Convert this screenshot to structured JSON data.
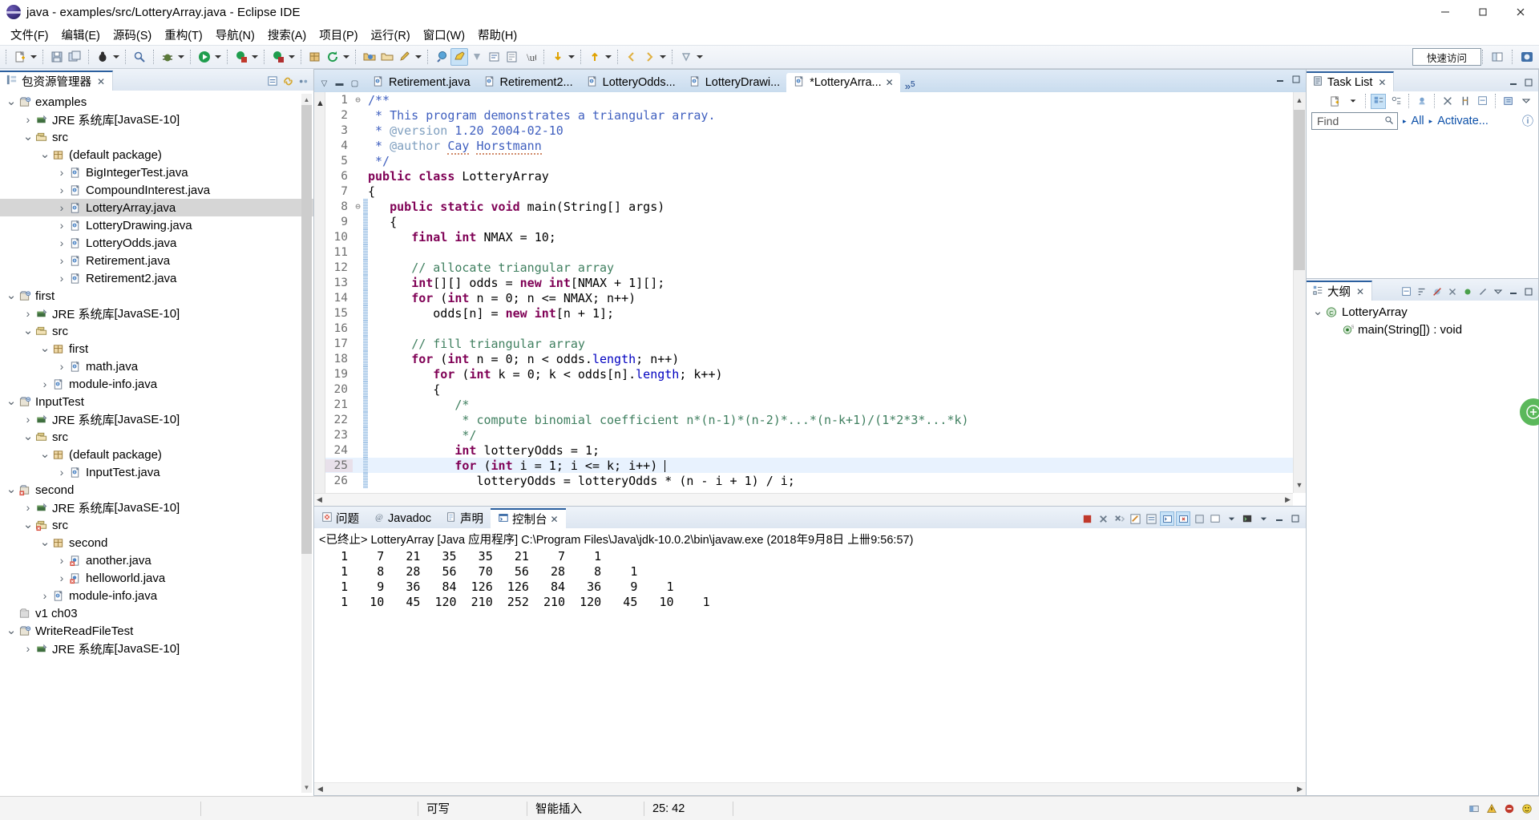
{
  "window": {
    "title": "java - examples/src/LotteryArray.java - Eclipse IDE",
    "app_icon": "eclipse-icon",
    "minimize": "—",
    "maximize": "❐",
    "close": "✕"
  },
  "menubar": {
    "items": [
      {
        "label": "文件(F)",
        "name": "menu-file"
      },
      {
        "label": "编辑(E)",
        "name": "menu-edit"
      },
      {
        "label": "源码(S)",
        "name": "menu-source"
      },
      {
        "label": "重构(T)",
        "name": "menu-refactor"
      },
      {
        "label": "导航(N)",
        "name": "menu-navigate"
      },
      {
        "label": "搜索(A)",
        "name": "menu-search"
      },
      {
        "label": "项目(P)",
        "name": "menu-project"
      },
      {
        "label": "运行(R)",
        "name": "menu-run"
      },
      {
        "label": "窗口(W)",
        "name": "menu-window"
      },
      {
        "label": "帮助(H)",
        "name": "menu-help"
      }
    ]
  },
  "toolbar": {
    "quick_access": "快速访问"
  },
  "package_explorer": {
    "tab_label": "包资源管理器",
    "tree": [
      {
        "indent": 0,
        "twist": "open",
        "icon": "java-project-icon",
        "label": "examples",
        "dim": ""
      },
      {
        "indent": 1,
        "twist": "closed",
        "icon": "jre-library-icon",
        "label": "JRE 系统库 ",
        "dim": "[JavaSE-10]"
      },
      {
        "indent": 1,
        "twist": "open",
        "icon": "source-folder-icon",
        "label": "src",
        "dim": ""
      },
      {
        "indent": 2,
        "twist": "open",
        "icon": "package-icon",
        "label": "(default package)",
        "dim": ""
      },
      {
        "indent": 3,
        "twist": "closed",
        "icon": "java-file-icon",
        "label": "BigIntegerTest.java",
        "dim": ""
      },
      {
        "indent": 3,
        "twist": "closed",
        "icon": "java-file-icon",
        "label": "CompoundInterest.java",
        "dim": ""
      },
      {
        "indent": 3,
        "twist": "closed",
        "icon": "java-file-icon",
        "label": "LotteryArray.java",
        "dim": "",
        "selected": true
      },
      {
        "indent": 3,
        "twist": "closed",
        "icon": "java-file-icon",
        "label": "LotteryDrawing.java",
        "dim": ""
      },
      {
        "indent": 3,
        "twist": "closed",
        "icon": "java-file-icon",
        "label": "LotteryOdds.java",
        "dim": ""
      },
      {
        "indent": 3,
        "twist": "closed",
        "icon": "java-file-icon",
        "label": "Retirement.java",
        "dim": ""
      },
      {
        "indent": 3,
        "twist": "closed",
        "icon": "java-file-icon",
        "label": "Retirement2.java",
        "dim": ""
      },
      {
        "indent": 0,
        "twist": "open",
        "icon": "java-project-icon",
        "label": "first",
        "dim": ""
      },
      {
        "indent": 1,
        "twist": "closed",
        "icon": "jre-library-icon",
        "label": "JRE 系统库 ",
        "dim": "[JavaSE-10]"
      },
      {
        "indent": 1,
        "twist": "open",
        "icon": "source-folder-icon",
        "label": "src",
        "dim": ""
      },
      {
        "indent": 2,
        "twist": "open",
        "icon": "package-icon",
        "label": "first",
        "dim": ""
      },
      {
        "indent": 3,
        "twist": "closed",
        "icon": "java-file-icon",
        "label": "math.java",
        "dim": ""
      },
      {
        "indent": 2,
        "twist": "closed",
        "icon": "java-file-icon",
        "label": "module-info.java",
        "dim": ""
      },
      {
        "indent": 0,
        "twist": "open",
        "icon": "java-project-icon",
        "label": "InputTest",
        "dim": ""
      },
      {
        "indent": 1,
        "twist": "closed",
        "icon": "jre-library-icon",
        "label": "JRE 系统库 ",
        "dim": "[JavaSE-10]"
      },
      {
        "indent": 1,
        "twist": "open",
        "icon": "source-folder-icon",
        "label": "src",
        "dim": ""
      },
      {
        "indent": 2,
        "twist": "open",
        "icon": "package-icon",
        "label": "(default package)",
        "dim": ""
      },
      {
        "indent": 3,
        "twist": "closed",
        "icon": "java-file-icon",
        "label": "InputTest.java",
        "dim": ""
      },
      {
        "indent": 0,
        "twist": "open",
        "icon": "java-project-error-icon",
        "label": "second",
        "dim": ""
      },
      {
        "indent": 1,
        "twist": "closed",
        "icon": "jre-library-icon",
        "label": "JRE 系统库 ",
        "dim": "[JavaSE-10]"
      },
      {
        "indent": 1,
        "twist": "open",
        "icon": "source-folder-error-icon",
        "label": "src",
        "dim": ""
      },
      {
        "indent": 2,
        "twist": "open",
        "icon": "package-icon",
        "label": "second",
        "dim": ""
      },
      {
        "indent": 3,
        "twist": "closed",
        "icon": "java-file-error-icon",
        "label": "another.java",
        "dim": ""
      },
      {
        "indent": 3,
        "twist": "closed",
        "icon": "java-file-error-icon",
        "label": "helloworld.java",
        "dim": ""
      },
      {
        "indent": 2,
        "twist": "closed",
        "icon": "java-file-icon",
        "label": "module-info.java",
        "dim": ""
      },
      {
        "indent": 0,
        "twist": "none",
        "icon": "closed-project-icon",
        "label": "v1 ch03",
        "dim": ""
      },
      {
        "indent": 0,
        "twist": "open",
        "icon": "java-project-icon",
        "label": "WriteReadFileTest",
        "dim": ""
      },
      {
        "indent": 1,
        "twist": "closed",
        "icon": "jre-library-icon",
        "label": "JRE 系统库 ",
        "dim": "[JavaSE-10]"
      }
    ]
  },
  "editor": {
    "tabs": [
      {
        "label": "Retirement.java",
        "active": false,
        "dirty": false,
        "icon": "java-file-icon"
      },
      {
        "label": "Retirement2...",
        "active": false,
        "dirty": false,
        "icon": "java-file-icon"
      },
      {
        "label": "LotteryOdds...",
        "active": false,
        "dirty": false,
        "icon": "java-file-icon"
      },
      {
        "label": "LotteryDrawi...",
        "active": false,
        "dirty": false,
        "icon": "java-file-icon"
      },
      {
        "label": "*LotteryArra...",
        "active": true,
        "dirty": true,
        "icon": "java-file-icon"
      }
    ],
    "overflow_label": "»",
    "overflow_count": "5",
    "close_glyph": "✕",
    "minimize_glyph": "—",
    "maximize_glyph": "❐",
    "lines": [
      {
        "n": "1",
        "fold": "⊖",
        "bar": false,
        "html": "<span class=\"jd\">/**</span>"
      },
      {
        "n": "2",
        "fold": "",
        "bar": false,
        "html": "<span class=\"jd\"> * This program demonstrates a triangular array.</span>"
      },
      {
        "n": "3",
        "fold": "",
        "bar": false,
        "html": "<span class=\"jd\"> * </span><span class=\"jdk\">@version</span><span class=\"jd\"> 1.20 2004-02-10</span>"
      },
      {
        "n": "4",
        "fold": "",
        "bar": false,
        "html": "<span class=\"jd\"> * </span><span class=\"jdk\">@author</span><span class=\"jd\"> </span><span class=\"jd sq\">Cay</span><span class=\"jd\"> </span><span class=\"jd sq\">Horstmann</span>"
      },
      {
        "n": "5",
        "fold": "",
        "bar": false,
        "html": "<span class=\"jd\"> */</span>"
      },
      {
        "n": "6",
        "fold": "",
        "bar": false,
        "html": "<span class=\"kw\">public class</span> LotteryArray"
      },
      {
        "n": "7",
        "fold": "",
        "bar": false,
        "html": "{"
      },
      {
        "n": "8",
        "fold": "⊖",
        "bar": true,
        "html": "   <span class=\"kw\">public static void</span> main(String[] args)"
      },
      {
        "n": "9",
        "fold": "",
        "bar": true,
        "html": "   {"
      },
      {
        "n": "10",
        "fold": "",
        "bar": true,
        "html": "      <span class=\"kw\">final int</span> NMAX = <span class=\"num0\">10</span>;"
      },
      {
        "n": "11",
        "fold": "",
        "bar": true,
        "html": ""
      },
      {
        "n": "12",
        "fold": "",
        "bar": true,
        "html": "      <span class=\"cm\">// allocate triangular array</span>"
      },
      {
        "n": "13",
        "fold": "",
        "bar": true,
        "html": "      <span class=\"kw\">int</span>[][] odds = <span class=\"kw\">new int</span>[NMAX + <span class=\"num0\">1</span>][];"
      },
      {
        "n": "14",
        "fold": "",
        "bar": true,
        "html": "      <span class=\"kw\">for</span> (<span class=\"kw\">int</span> n = <span class=\"num0\">0</span>; n &lt;= NMAX; n++)"
      },
      {
        "n": "15",
        "fold": "",
        "bar": true,
        "html": "         odds[n] = <span class=\"kw\">new int</span>[n + <span class=\"num0\">1</span>];"
      },
      {
        "n": "16",
        "fold": "",
        "bar": true,
        "html": ""
      },
      {
        "n": "17",
        "fold": "",
        "bar": true,
        "html": "      <span class=\"cm\">// fill triangular array</span>"
      },
      {
        "n": "18",
        "fold": "",
        "bar": true,
        "html": "      <span class=\"kw\">for</span> (<span class=\"kw\">int</span> n = <span class=\"num0\">0</span>; n &lt; odds.<span class=\"fld\">length</span>; n++)"
      },
      {
        "n": "19",
        "fold": "",
        "bar": true,
        "html": "         <span class=\"kw\">for</span> (<span class=\"kw\">int</span> k = <span class=\"num0\">0</span>; k &lt; odds[n].<span class=\"fld\">length</span>; k++)"
      },
      {
        "n": "20",
        "fold": "",
        "bar": true,
        "html": "         {"
      },
      {
        "n": "21",
        "fold": "",
        "bar": true,
        "html": "            <span class=\"cm\">/*</span>"
      },
      {
        "n": "22",
        "fold": "",
        "bar": true,
        "html": "            <span class=\"cm\"> * compute binomial coefficient n*(n-1)*(n-2)*...*(n-k+1)/(1*2*3*...*k)</span>"
      },
      {
        "n": "23",
        "fold": "",
        "bar": true,
        "html": "            <span class=\"cm\"> */</span>"
      },
      {
        "n": "24",
        "fold": "",
        "bar": true,
        "html": "            <span class=\"kw\">int</span> lotteryOdds = <span class=\"num0\">1</span>;"
      },
      {
        "n": "25",
        "fold": "",
        "bar": true,
        "html": "            <span class=\"kw\">for</span> (<span class=\"kw\">int</span> i = <span class=\"num0\">1</span>; i &lt;= k; i++) <span class=\"caret-bar\"></span>",
        "highlight": true
      },
      {
        "n": "26",
        "fold": "",
        "bar": true,
        "html": "               lotteryOdds = lotteryOdds * (n - i + <span class=\"num0\">1</span>) / i;"
      }
    ]
  },
  "console": {
    "tabs": [
      {
        "label": "问题",
        "icon": "problems-icon",
        "active": false
      },
      {
        "label": "Javadoc",
        "icon": "javadoc-icon",
        "active": false
      },
      {
        "label": "声明",
        "icon": "declaration-icon",
        "active": false
      },
      {
        "label": "控制台",
        "icon": "console-icon",
        "active": true
      }
    ],
    "close_glyph": "✕",
    "header": "<已终止> LotteryArray [Java 应用程序] C:\\Program Files\\Java\\jdk-10.0.2\\bin\\javaw.exe  (2018年9月8日 上卌9:56:57)",
    "output_lines": [
      "   1    7   21   35   35   21    7    1",
      "   1    8   28   56   70   56   28    8    1",
      "   1    9   36   84  126  126   84   36    9    1",
      "   1   10   45  120  210  252  210  120   45   10    1"
    ]
  },
  "task_list": {
    "tab_label": "Task List",
    "close_glyph": "✕",
    "find_placeholder": "Find",
    "all_label": "All",
    "activate_label": "Activate...",
    "help_glyph": "?"
  },
  "outline": {
    "tab_label": "大纲",
    "close_glyph": "✕",
    "rows": [
      {
        "indent": 0,
        "twist": "open",
        "icon": "class-icon",
        "label": "LotteryArray"
      },
      {
        "indent": 1,
        "twist": "none",
        "icon": "method-icon",
        "label": "main(String[]) : void"
      }
    ]
  },
  "statusbar": {
    "writable": "可写",
    "insert_mode": "智能插入",
    "position": "25: 42"
  }
}
